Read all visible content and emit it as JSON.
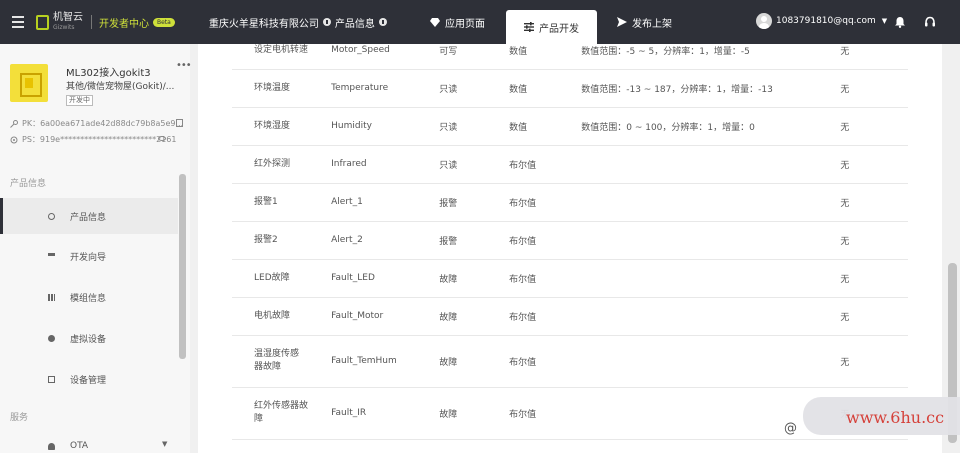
{
  "header": {
    "logo_cn": "机智云",
    "logo_en": "Gizwits",
    "dev_center": "开发者中心",
    "beta": "Beta",
    "company": "重庆火羊星科技有限公司",
    "product_info": "产品信息",
    "nav": [
      {
        "label": "应用页面"
      },
      {
        "label": "产品开发"
      },
      {
        "label": "发布上架"
      }
    ],
    "user_email": "1083791810@qq.com"
  },
  "sidebar": {
    "product_name": "ML302接入gokit3",
    "product_category": "其他/微信宠物屋(Gokit)/...",
    "product_status": "开发中",
    "pk": "PK：6a00ea671ade42d88dc79b8a5e9...",
    "ps": "PS：919e************************2161",
    "section1": "产品信息",
    "section2": "服务",
    "items": [
      {
        "label": "产品信息"
      },
      {
        "label": "开发向导"
      },
      {
        "label": "模组信息"
      },
      {
        "label": "虚拟设备"
      },
      {
        "label": "设备管理"
      },
      {
        "label": "OTA"
      }
    ]
  },
  "table": {
    "rows": [
      {
        "name": "设定电机转速",
        "id": "Motor_Speed",
        "rw": "可写",
        "type": "数值",
        "desc": "数值范围：-5 ~ 5，分辨率：1，增量：-5",
        "remark": "无"
      },
      {
        "name": "环境温度",
        "id": "Temperature",
        "rw": "只读",
        "type": "数值",
        "desc": "数值范围：-13 ~ 187，分辨率：1，增量：-13",
        "remark": "无"
      },
      {
        "name": "环境湿度",
        "id": "Humidity",
        "rw": "只读",
        "type": "数值",
        "desc": "数值范围：0 ~ 100，分辨率：1，增量：0",
        "remark": "无"
      },
      {
        "name": "红外探测",
        "id": "Infrared",
        "rw": "只读",
        "type": "布尔值",
        "desc": "",
        "remark": "无"
      },
      {
        "name": "报警1",
        "id": "Alert_1",
        "rw": "报警",
        "type": "布尔值",
        "desc": "",
        "remark": "无"
      },
      {
        "name": "报警2",
        "id": "Alert_2",
        "rw": "报警",
        "type": "布尔值",
        "desc": "",
        "remark": "无"
      },
      {
        "name": "LED故障",
        "id": "Fault_LED",
        "rw": "故障",
        "type": "布尔值",
        "desc": "",
        "remark": "无"
      },
      {
        "name": "电机故障",
        "id": "Fault_Motor",
        "rw": "故障",
        "type": "布尔值",
        "desc": "",
        "remark": "无"
      },
      {
        "name": "温湿度传感器故障",
        "id": "Fault_TemHum",
        "rw": "故障",
        "type": "布尔值",
        "desc": "",
        "remark": "无"
      },
      {
        "name": "红外传感器故障",
        "id": "Fault_IR",
        "rw": "故障",
        "type": "布尔值",
        "desc": "",
        "remark": "无"
      }
    ]
  },
  "watermark": {
    "text": "www.6hu.cc",
    "at": "@"
  }
}
